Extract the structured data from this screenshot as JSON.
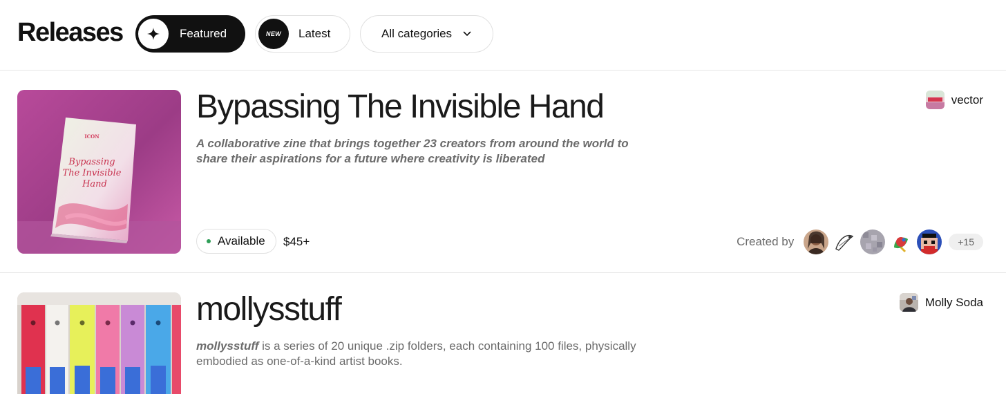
{
  "header": {
    "title": "Releases",
    "featured_label": "Featured",
    "latest_label": "Latest",
    "latest_badge": "NEW",
    "category_label": "All categories"
  },
  "releases": [
    {
      "title": "Bypassing The Invisible Hand",
      "description": "A collaborative zine that brings together 23 creators from around the world to share their aspirations for a future where creativity is liberated",
      "creator": "vector",
      "status": "Available",
      "price": "$45+",
      "created_by_label": "Created by",
      "more_creators": "+15",
      "cover_text": "Bypassing The Invisible Hand"
    },
    {
      "title": "mollysstuff",
      "description_em": "mollysstuff",
      "description_rest": " is a series of 20 unique .zip folders, each containing 100 files, physically embodied as one-of-a-kind artist books.",
      "creator": "Molly Soda"
    }
  ],
  "icons": {
    "featured": "sparkle-icon",
    "category": "chevron-down-icon"
  },
  "colors": {
    "available_dot": "#2f9e57",
    "featured_pill": "#111111"
  }
}
